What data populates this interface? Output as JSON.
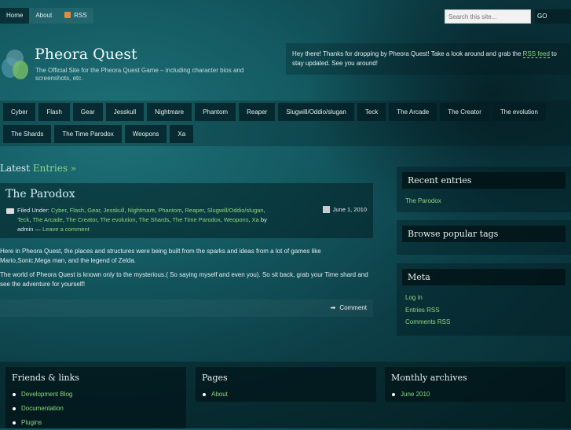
{
  "topnav": {
    "items": [
      "Home",
      "About",
      "RSS"
    ]
  },
  "search": {
    "placeholder": "Search this site...",
    "go": "GO"
  },
  "site": {
    "title": "Pheora Quest",
    "tagline": "The Official Site for the Pheora Quest Game – including character bios and screenshots, etc."
  },
  "welcome": {
    "before": "Hey there! Thanks for dropping by Pheora Quest! Take a look around and grab the ",
    "link": "RSS feed",
    "after": " to stay updated. See you around!"
  },
  "categories": [
    "Cyber",
    "Flash",
    "Gear",
    "Jesskull",
    "Nightmare",
    "Phantom",
    "Reaper",
    "Slugwill/Oddio/slugan",
    "Teck",
    "The Arcade",
    "The Creator",
    "The evolution",
    "The Shards",
    "The Time Parodox",
    "Weopons",
    "Xa"
  ],
  "latest": {
    "label": "Latest",
    "link": "Entries »"
  },
  "post": {
    "title": "The Parodox",
    "filed_under": "Filed Under:",
    "by": "by",
    "author": "admin",
    "dash": "—",
    "leave_comment": "Leave a comment",
    "date": "June 1, 2010",
    "paragraphs": [
      "Here in Pheora Quest, the places and structures were being built from the sparks and ideas from a lot of games like Mario,Sonic,Mega man, and the legend of Zelda.",
      "The world of Pheora Quest is known only to the mysterious.( So saying myself and even you). So sit back, grab your Time shard and see the adventure for yourself!"
    ],
    "comment": "Comment"
  },
  "sidebar": {
    "recent_title": "Recent entries",
    "recent": [
      "The Parodox"
    ],
    "tags_title": "Browse popular tags",
    "meta_title": "Meta",
    "meta": [
      "Log in",
      "Entries RSS",
      "Comments RSS"
    ]
  },
  "footer": {
    "links_title": "Friends & links",
    "links": [
      "Development Blog",
      "Documentation",
      "Plugins"
    ],
    "pages_title": "Pages",
    "pages": [
      "About"
    ],
    "archives_title": "Monthly archives",
    "archives": [
      "June 2010"
    ]
  },
  "colors": {
    "link": "#8fd57f",
    "bg": "#145a62"
  }
}
